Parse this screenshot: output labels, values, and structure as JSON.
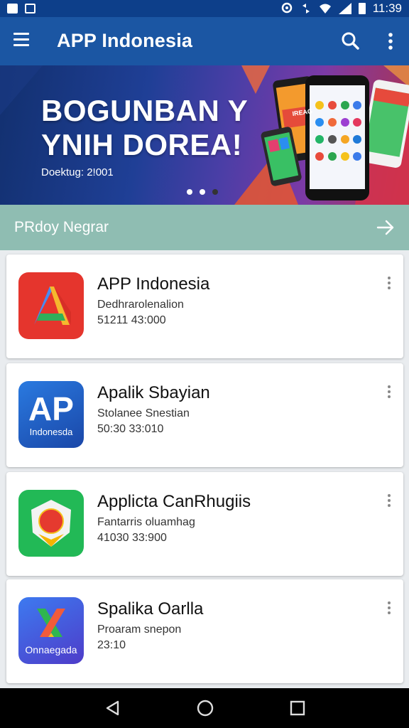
{
  "status_bar": {
    "time": "11:39",
    "icons": [
      "gallery-icon",
      "square-icon",
      "location-icon",
      "sync-icon",
      "wifi-icon",
      "signal-icon",
      "battery-icon"
    ]
  },
  "app_bar": {
    "title": "APP Indonesia",
    "icons": [
      "menu-icon",
      "search-icon",
      "more-vert-icon"
    ]
  },
  "banner": {
    "title_line1": "BOGUNBAN Y",
    "title_line2": "YNIH DOREA!",
    "subtitle": "Doektug: 2!001",
    "phone_label": "IREAG",
    "slides_total": 3,
    "active_slide": 2
  },
  "section": {
    "label": "PRdoy Negrar",
    "icon": "arrow-right-icon"
  },
  "apps": [
    {
      "title": "APP Indonesia",
      "subtitle": "Dedhrarolenalion",
      "meta": "51211 43:000",
      "icon": "red-a-logo-icon",
      "icon_color": "#e5352d"
    },
    {
      "title": "Apalik Sbayian",
      "subtitle": "Stolanee Snestian",
      "meta": "50:30 33:010",
      "icon": "ap-indonesia-logo-icon",
      "icon_text_big": "AP",
      "icon_text_small": "Indonesda",
      "icon_color": "#1d5fc0"
    },
    {
      "title": "Applicta CanRhugiis",
      "subtitle": "Fantarris oluamhag",
      "meta": "41030 33:900",
      "icon": "green-shield-logo-icon",
      "icon_color": "#22b956"
    },
    {
      "title": "Spalika Oarlla",
      "subtitle": "Proaram snepon",
      "meta": "23:10",
      "icon": "blue-x-logo-icon",
      "icon_text_small": "Onnaegada",
      "icon_color": "#3c56d6"
    }
  ],
  "nav_bar": {
    "icons": [
      "back-icon",
      "home-icon",
      "recents-icon"
    ]
  }
}
